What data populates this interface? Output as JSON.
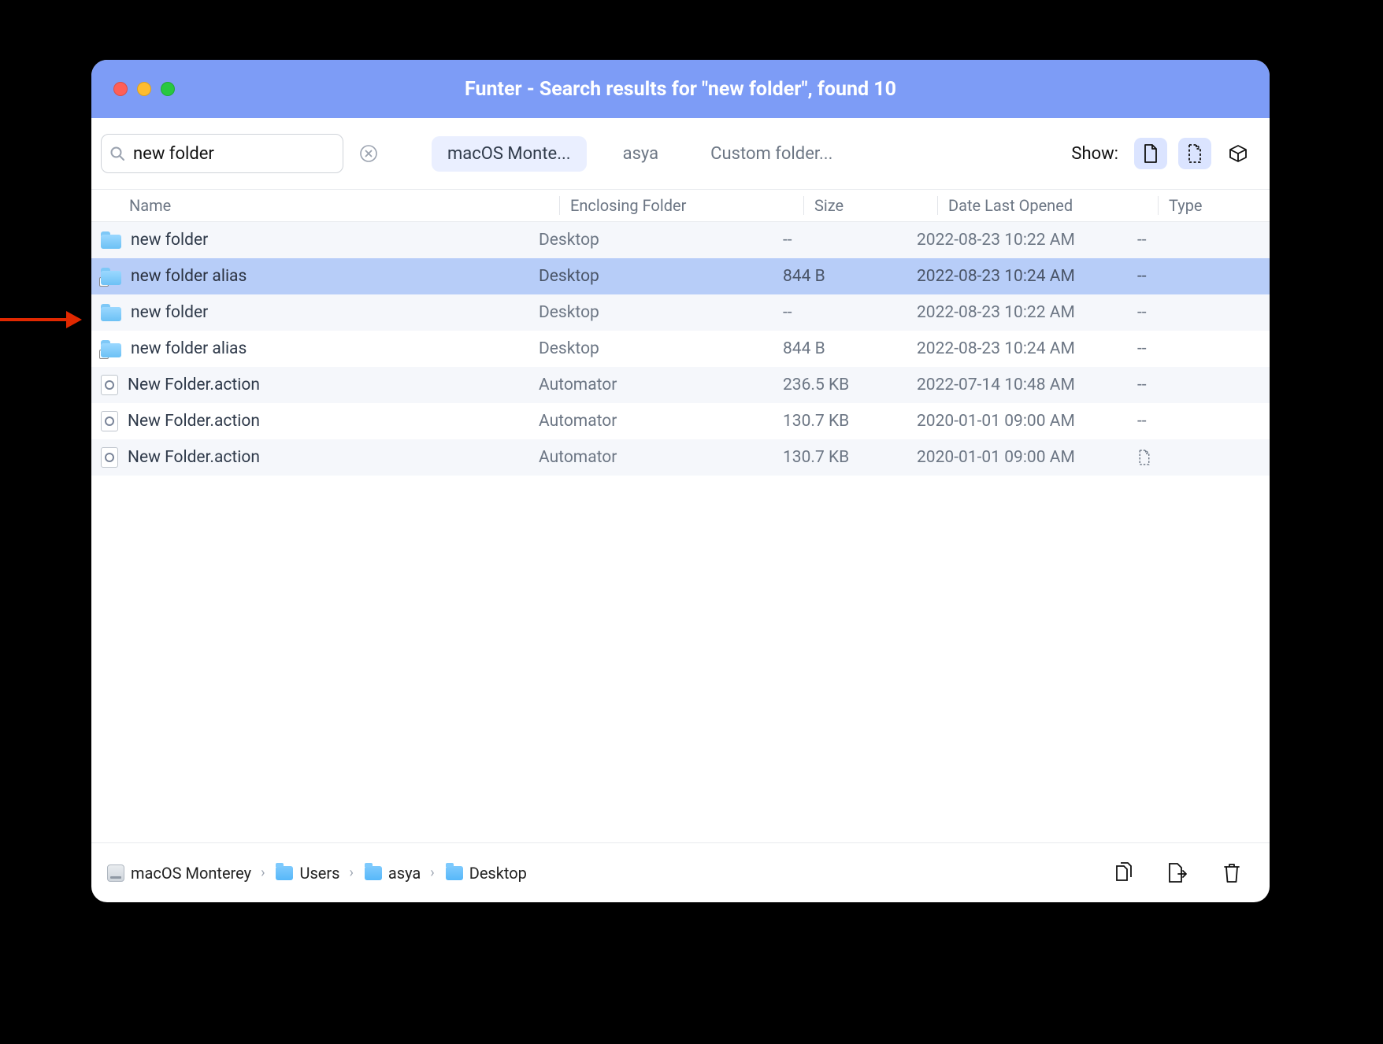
{
  "window": {
    "title": "Funter - Search results for \"new folder\", found 10"
  },
  "search": {
    "value": "new folder"
  },
  "scopes": {
    "items": [
      {
        "label": "macOS Monte...",
        "active": true
      },
      {
        "label": "asya",
        "active": false
      },
      {
        "label": "Custom folder...",
        "active": false
      }
    ]
  },
  "show_label": "Show:",
  "columns": {
    "name": "Name",
    "enclosing": "Enclosing Folder",
    "size": "Size",
    "date": "Date Last Opened",
    "type": "Type"
  },
  "rows": [
    {
      "icon": "folder",
      "name": "new folder",
      "enclosing": "Desktop",
      "size": "--",
      "date": "2022-08-23 10:22 AM",
      "type": "--",
      "selected": false
    },
    {
      "icon": "folder-alias",
      "name": "new folder alias",
      "enclosing": "Desktop",
      "size": "844 B",
      "date": "2022-08-23 10:24 AM",
      "type": "--",
      "selected": true
    },
    {
      "icon": "folder",
      "name": "new folder",
      "enclosing": "Desktop",
      "size": "--",
      "date": "2022-08-23 10:22 AM",
      "type": "--",
      "selected": false
    },
    {
      "icon": "folder-alias",
      "name": "new folder alias",
      "enclosing": "Desktop",
      "size": "844 B",
      "date": "2022-08-23 10:24 AM",
      "type": "--",
      "selected": false
    },
    {
      "icon": "action",
      "name": "New Folder.action",
      "enclosing": "Automator",
      "size": "236.5 KB",
      "date": "2022-07-14 10:48 AM",
      "type": "--",
      "selected": false
    },
    {
      "icon": "action",
      "name": "New Folder.action",
      "enclosing": "Automator",
      "size": "130.7 KB",
      "date": "2020-01-01 09:00 AM",
      "type": "--",
      "selected": false
    },
    {
      "icon": "action",
      "name": "New Folder.action",
      "enclosing": "Automator",
      "size": "130.7 KB",
      "date": "2020-01-01 09:00 AM",
      "type": "hidden",
      "selected": false
    }
  ],
  "path": {
    "segments": [
      {
        "icon": "disk",
        "label": "macOS Monterey"
      },
      {
        "icon": "folder",
        "label": "Users"
      },
      {
        "icon": "folder",
        "label": "asya"
      },
      {
        "icon": "folder",
        "label": "Desktop"
      }
    ]
  }
}
